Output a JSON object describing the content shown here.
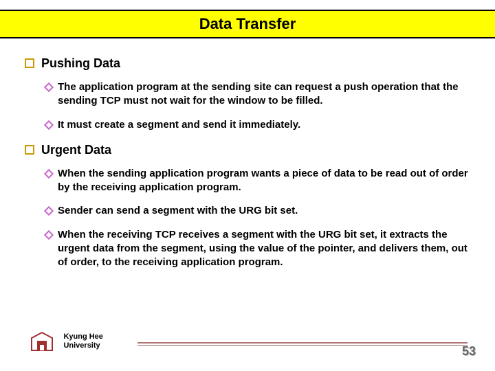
{
  "title": "Data Transfer",
  "sections": [
    {
      "heading": "Pushing Data",
      "items": [
        "The application program at the sending site can request a push operation that the sending TCP must not wait for the window to be filled.",
        "It must create a segment and send it immediately."
      ]
    },
    {
      "heading": "Urgent Data",
      "items": [
        "When the sending application program wants a piece of data to be read out of order by the receiving application program.",
        "Sender can send a segment with the URG bit set.",
        "When the receiving TCP receives a segment with the URG bit set, it extracts the urgent  data from the segment, using the value of the pointer, and delivers them, out of order, to the receiving application program."
      ]
    }
  ],
  "footer": {
    "line1": "Kyung Hee",
    "line2": "University"
  },
  "pageNumber": "53"
}
